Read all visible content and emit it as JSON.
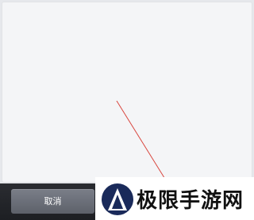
{
  "footer": {
    "cancel_label": "取消"
  },
  "watermark": {
    "text": "极限手游网",
    "logo_icon": "circle-triangle-logo-icon"
  },
  "colors": {
    "stroke": "#d9463e",
    "logo": "#1a2a5a",
    "footer_bg": "#1f2125",
    "button_bg": "#6b6f78"
  }
}
